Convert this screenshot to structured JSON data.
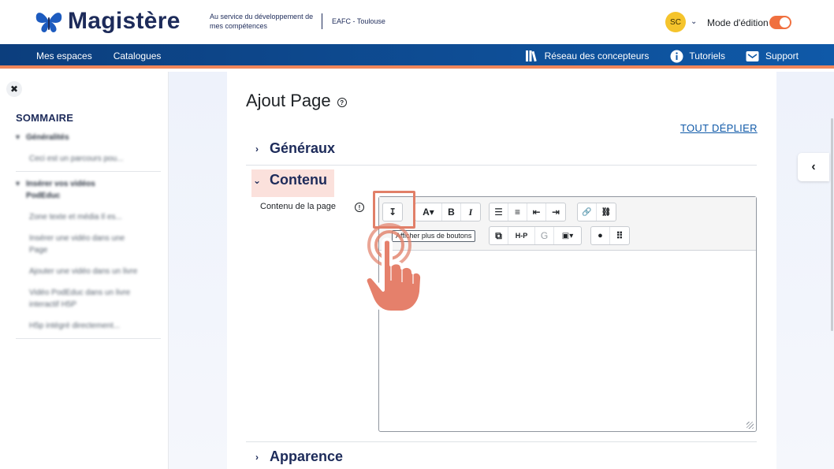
{
  "header": {
    "brand": "Magistère",
    "tagline": "Au service du développement de mes compétences",
    "academy": "EAFC - Toulouse",
    "user_initials": "SC",
    "edit_mode_label": "Mode d'édition",
    "edit_mode_on": true
  },
  "nav": {
    "left": [
      "Mes espaces",
      "Catalogues"
    ],
    "right": [
      {
        "label": "Réseau des concepteurs",
        "icon": "library-icon"
      },
      {
        "label": "Tutoriels",
        "icon": "info-circle-icon"
      },
      {
        "label": "Support",
        "icon": "mail-icon"
      }
    ]
  },
  "drawer": {
    "close_glyph": "✖",
    "title": "SOMMAIRE",
    "sections": [
      {
        "label": "Généralités",
        "items": [
          "Ceci est un parcours pou..."
        ]
      },
      {
        "label": "Insérer vos vidéos PodEduc",
        "items": [
          "Zone texte et média Il es...",
          "Insérer une vidéo dans une Page",
          "Ajouter une vidéo dans un livre",
          "Vidéo PodEduc dans un livre interactif H5P",
          "H5p intégré directement..."
        ]
      }
    ]
  },
  "main": {
    "title": "Ajout Page",
    "expand_all": "TOUT DÉPLIER",
    "sections": {
      "generaux": "Généraux",
      "contenu": "Contenu",
      "apparence": "Apparence"
    },
    "field_label": "Contenu de la page",
    "tooltip": "Afficher plus de boutons",
    "drawer_toggle_glyph": "‹"
  },
  "editor": {
    "row1": [
      {
        "glyph": "↧",
        "icon": "show-more-buttons-icon"
      },
      {
        "glyph": "A▾",
        "icon": "font-style-icon"
      },
      {
        "glyph": "B",
        "icon": "bold-icon"
      },
      {
        "glyph": "I",
        "icon": "italic-icon"
      },
      {
        "glyph": "☰",
        "icon": "unordered-list-icon"
      },
      {
        "glyph": "≡",
        "icon": "ordered-list-icon"
      },
      {
        "glyph": "⇤",
        "icon": "outdent-icon"
      },
      {
        "glyph": "⇥",
        "icon": "indent-icon"
      },
      {
        "glyph": "🔗",
        "icon": "link-icon"
      },
      {
        "glyph": "⛓",
        "icon": "unlink-icon"
      }
    ],
    "row2": [
      {
        "glyph": "⧉",
        "icon": "copy-icon"
      },
      {
        "glyph": "H-P",
        "icon": "h5p-icon"
      },
      {
        "glyph": "G",
        "icon": "glossary-icon"
      },
      {
        "glyph": "▣▾",
        "icon": "media-icon"
      },
      {
        "glyph": "●",
        "icon": "accessibility-icon"
      },
      {
        "glyph": "⠿",
        "icon": "grid-icon"
      }
    ]
  },
  "colors": {
    "brand_navy": "#1d2b5a",
    "nav_blue": "#0f59a8",
    "accent_orange": "#f0865b",
    "highlight_box": "#e17f68"
  }
}
